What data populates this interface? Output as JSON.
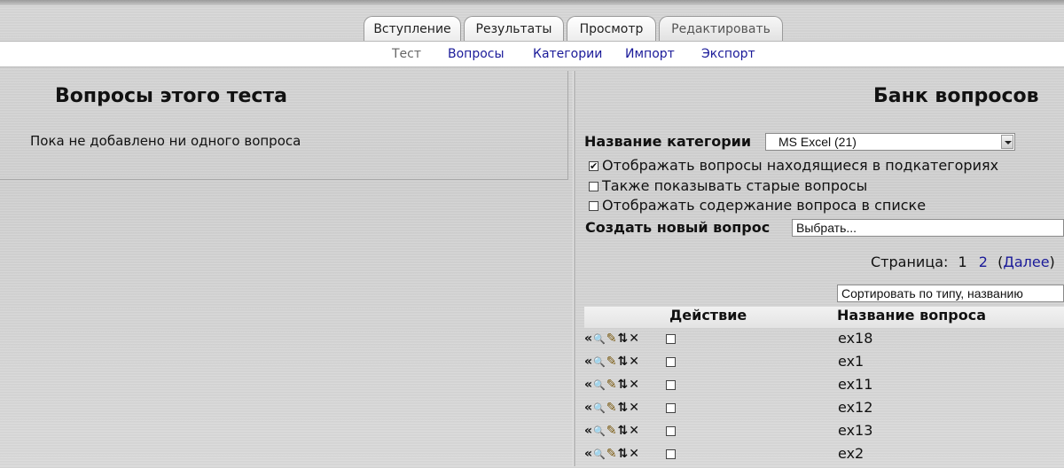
{
  "tabs": [
    "Вступление",
    "Результаты",
    "Просмотр",
    "Редактировать"
  ],
  "subtabs": [
    "Тест",
    "Вопросы",
    "Категории",
    "Импорт",
    "Экспорт"
  ],
  "left": {
    "title": "Вопросы этого теста",
    "empty_message": "Пока не добавлено ни одного вопроса"
  },
  "bank": {
    "title": "Банк вопросов",
    "category_label": "Название категории",
    "category_value": "MS Excel (21)",
    "checkboxes": [
      {
        "label": "Отображать вопросы находящиеся в подкатегориях",
        "checked": true
      },
      {
        "label": "Также показывать старые вопросы",
        "checked": false
      },
      {
        "label": "Отображать содержание вопроса в списке",
        "checked": false
      }
    ],
    "create_label": "Создать новый вопрос",
    "create_value": "Выбрать...",
    "pager": {
      "label": "Страница:",
      "current": "1",
      "next_page": "2",
      "next_label": "Далее"
    },
    "sort_value": "Сортировать по типу, названию",
    "col_action": "Действие",
    "col_name": "Название вопроса",
    "questions": [
      "ex18",
      "ex1",
      "ex11",
      "ex12",
      "ex13",
      "ex2"
    ]
  },
  "icons": [
    "add-to-quiz-icon",
    "preview-icon",
    "edit-icon",
    "move-icon",
    "delete-icon"
  ],
  "colors": {
    "link": "#1a1a99",
    "inactive_tab": "#555555"
  }
}
